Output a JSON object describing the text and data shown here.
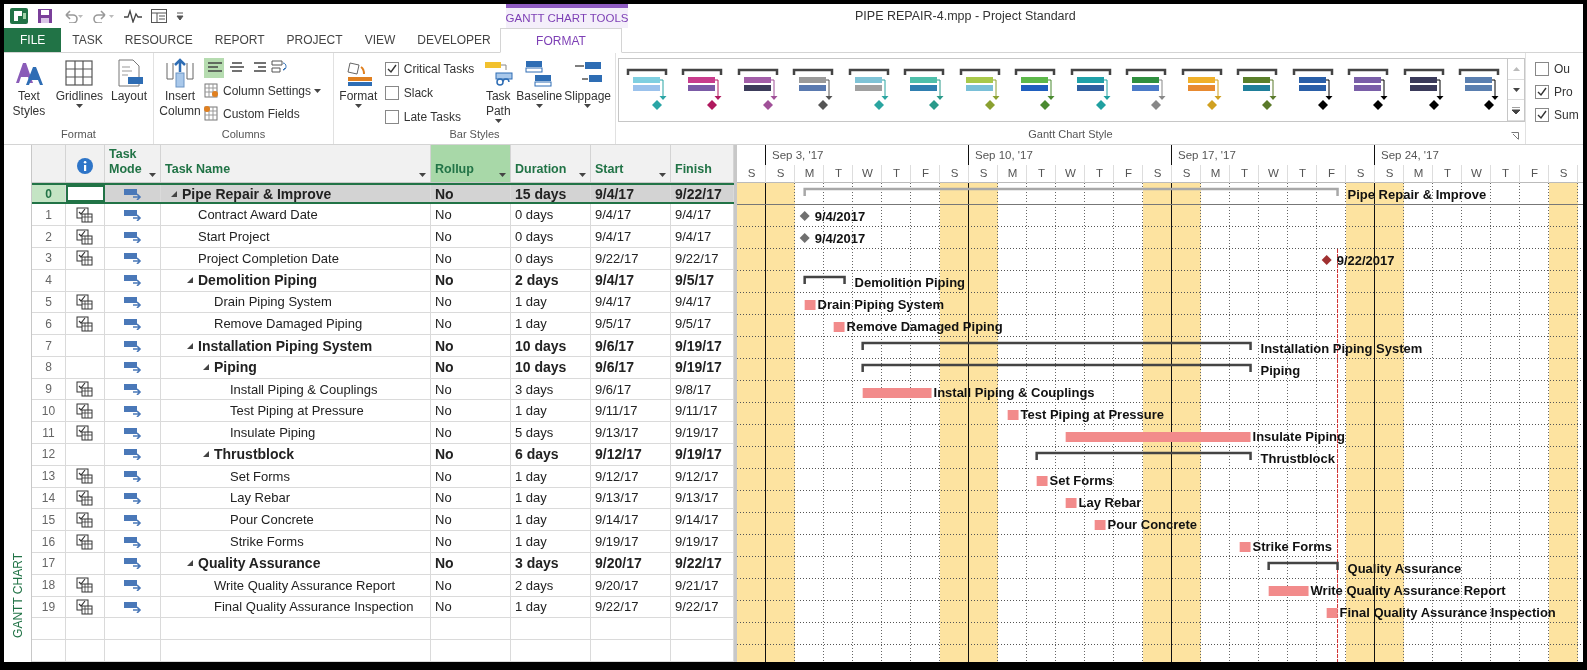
{
  "window": {
    "title": "PIPE REPAIR-4.mpp - Project Standard",
    "context_tab_group": "GANTT CHART TOOLS"
  },
  "tabs": [
    {
      "label": "FILE",
      "kind": "file",
      "selected": false
    },
    {
      "label": "TASK",
      "kind": "tab",
      "selected": false
    },
    {
      "label": "RESOURCE",
      "kind": "tab",
      "selected": false
    },
    {
      "label": "REPORT",
      "kind": "tab",
      "selected": false
    },
    {
      "label": "PROJECT",
      "kind": "tab",
      "selected": false
    },
    {
      "label": "VIEW",
      "kind": "tab",
      "selected": false
    },
    {
      "label": "DEVELOPER",
      "kind": "tab",
      "selected": false
    },
    {
      "label": "FORMAT",
      "kind": "context",
      "selected": true
    }
  ],
  "ribbon_groups": [
    {
      "label": "Format",
      "kind": "format",
      "buttons": [
        {
          "label": "Text Styles",
          "dropdown": false
        },
        {
          "label": "Gridlines",
          "dropdown": true
        },
        {
          "label": "Layout",
          "dropdown": false
        }
      ]
    },
    {
      "label": "Columns",
      "kind": "columns",
      "buttons": [
        {
          "label": "Insert Column",
          "dropdown": false
        }
      ],
      "alignment": [
        {
          "selected": true
        },
        {
          "selected": false
        },
        {
          "selected": false
        }
      ],
      "small_buttons": [
        {
          "label": "Column Settings",
          "dropdown": true
        },
        {
          "label": "Custom Fields",
          "dropdown": false
        }
      ]
    },
    {
      "label": "Bar Styles",
      "kind": "bar_styles",
      "buttons": [
        {
          "label": "Format",
          "dropdown": true
        }
      ],
      "checkboxes": [
        {
          "label": "Critical Tasks",
          "checked": true
        },
        {
          "label": "Slack",
          "checked": false
        },
        {
          "label": "Late Tasks",
          "checked": false
        }
      ],
      "more_buttons": [
        {
          "label": "Task Path",
          "dropdown": true
        },
        {
          "label": "Baseline",
          "dropdown": true
        },
        {
          "label": "Slippage",
          "dropdown": true
        }
      ]
    },
    {
      "label": "Gantt Chart Style",
      "kind": "gallery",
      "swatches": [
        {
          "parts": [
            {
              "kind": "bar",
              "color": "#7fcfe0"
            },
            {
              "kind": "bar",
              "color": "#9bc2ec"
            },
            {
              "kind": "milestone",
              "color": "#2aa5a5"
            }
          ]
        },
        {
          "parts": [
            {
              "kind": "bar",
              "color": "#c83c8c"
            },
            {
              "kind": "bar",
              "color": "#7b5aa6"
            },
            {
              "kind": "milestone",
              "color": "#b0185e"
            }
          ]
        },
        {
          "parts": [
            {
              "kind": "bar",
              "color": "#a25ea8"
            },
            {
              "kind": "bar",
              "color": "#3c3c5a"
            },
            {
              "kind": "milestone",
              "color": "#a05098"
            }
          ]
        },
        {
          "parts": [
            {
              "kind": "bar",
              "color": "#9a9a9a"
            },
            {
              "kind": "bar",
              "color": "#5a7ab0"
            },
            {
              "kind": "milestone",
              "color": "#555555"
            }
          ]
        },
        {
          "parts": [
            {
              "kind": "bar",
              "color": "#7fc3d6"
            },
            {
              "kind": "bar",
              "color": "#a0a0a0"
            },
            {
              "kind": "milestone",
              "color": "#2aa5a0"
            }
          ]
        },
        {
          "parts": [
            {
              "kind": "bar",
              "color": "#4fbfaa"
            },
            {
              "kind": "bar",
              "color": "#2f7fb0"
            },
            {
              "kind": "milestone",
              "color": "#2a9a8a"
            }
          ]
        },
        {
          "parts": [
            {
              "kind": "bar",
              "color": "#a8c84a"
            },
            {
              "kind": "bar",
              "color": "#7ac0d8"
            },
            {
              "kind": "milestone",
              "color": "#8aa030"
            }
          ]
        },
        {
          "parts": [
            {
              "kind": "bar",
              "color": "#5db84a"
            },
            {
              "kind": "bar",
              "color": "#1f5fbf"
            },
            {
              "kind": "milestone",
              "color": "#4a8a30"
            }
          ]
        },
        {
          "parts": [
            {
              "kind": "bar",
              "color": "#20a0a8"
            },
            {
              "kind": "bar",
              "color": "#2f5fa0"
            },
            {
              "kind": "milestone",
              "color": "#20a0a0"
            }
          ]
        },
        {
          "parts": [
            {
              "kind": "bar",
              "color": "#2f8f3f"
            },
            {
              "kind": "bar",
              "color": "#4a7ac8"
            },
            {
              "kind": "milestone",
              "color": "#888888"
            }
          ]
        },
        {
          "parts": [
            {
              "kind": "bar",
              "color": "#f0b02a"
            },
            {
              "kind": "bar",
              "color": "#e88a30"
            },
            {
              "kind": "milestone",
              "color": "#d0a020"
            }
          ]
        },
        {
          "parts": [
            {
              "kind": "bar",
              "color": "#5a7f2a"
            },
            {
              "kind": "bar",
              "color": "#1f7f9a"
            },
            {
              "kind": "milestone",
              "color": "#5a7a2a"
            }
          ]
        },
        {
          "parts": [
            {
              "kind": "bar",
              "color": "#2a5fa8"
            },
            {
              "kind": "bar",
              "color": "#2a5fa8"
            },
            {
              "kind": "milestone",
              "color": "#000000"
            }
          ]
        },
        {
          "parts": [
            {
              "kind": "bar",
              "color": "#7a5fa8"
            },
            {
              "kind": "bar",
              "color": "#7a5fa8"
            },
            {
              "kind": "milestone",
              "color": "#000000"
            }
          ]
        },
        {
          "parts": [
            {
              "kind": "bar",
              "color": "#3a3a5a"
            },
            {
              "kind": "bar",
              "color": "#3a3a5a"
            },
            {
              "kind": "milestone",
              "color": "#000000"
            }
          ]
        },
        {
          "parts": [
            {
              "kind": "bar",
              "color": "#5a7fb0"
            },
            {
              "kind": "bar",
              "color": "#5a7fb0"
            },
            {
              "kind": "milestone",
              "color": "#000000"
            }
          ]
        }
      ]
    },
    {
      "kind": "show_hide",
      "checkboxes": [
        {
          "label": "Ou",
          "checked": false
        },
        {
          "label": "Pro",
          "checked": true
        },
        {
          "label": "Sum",
          "checked": true
        }
      ]
    }
  ],
  "view_label": "GANTT CHART",
  "columns": [
    {
      "kind": "info",
      "selected": false
    },
    {
      "kind": "text",
      "label": "Task Mode",
      "dropdown": true,
      "selected": false
    },
    {
      "kind": "text",
      "label": "Task Name",
      "dropdown": true,
      "selected": false
    },
    {
      "kind": "text",
      "label": "Rollup",
      "dropdown": true,
      "selected": true
    },
    {
      "kind": "text",
      "label": "Duration",
      "dropdown": true,
      "selected": false
    },
    {
      "kind": "text",
      "label": "Start",
      "dropdown": true,
      "selected": false
    },
    {
      "kind": "text",
      "label": "Finish",
      "dropdown": false,
      "selected": false
    }
  ],
  "timescale": {
    "weeks": [
      {
        "label": "Sep 3, '17"
      },
      {
        "label": "Sep 10, '17"
      },
      {
        "label": "Sep 17, '17"
      },
      {
        "label": "Sep 24, '17"
      }
    ],
    "days": [
      {
        "label": "S",
        "weekend": true
      },
      {
        "label": "S",
        "weekend": true
      },
      {
        "label": "M",
        "weekend": false
      },
      {
        "label": "T",
        "weekend": false
      },
      {
        "label": "W",
        "weekend": false
      },
      {
        "label": "T",
        "weekend": false
      },
      {
        "label": "F",
        "weekend": false
      },
      {
        "label": "S",
        "weekend": true
      },
      {
        "label": "S",
        "weekend": true
      },
      {
        "label": "M",
        "weekend": false
      },
      {
        "label": "T",
        "weekend": false
      },
      {
        "label": "W",
        "weekend": false
      },
      {
        "label": "T",
        "weekend": false
      },
      {
        "label": "F",
        "weekend": false
      },
      {
        "label": "S",
        "weekend": true
      },
      {
        "label": "S",
        "weekend": true
      },
      {
        "label": "M",
        "weekend": false
      },
      {
        "label": "T",
        "weekend": false
      },
      {
        "label": "W",
        "weekend": false
      },
      {
        "label": "T",
        "weekend": false
      },
      {
        "label": "F",
        "weekend": false
      },
      {
        "label": "S",
        "weekend": true
      },
      {
        "label": "S",
        "weekend": true
      },
      {
        "label": "M",
        "weekend": false
      },
      {
        "label": "T",
        "weekend": false
      },
      {
        "label": "W",
        "weekend": false
      },
      {
        "label": "T",
        "weekend": false
      },
      {
        "label": "F",
        "weekend": false
      },
      {
        "label": "S",
        "weekend": true
      }
    ]
  },
  "tasks": [
    {
      "id": "0",
      "name": "Pipe Repair & Improve",
      "kind": "project",
      "expanded": true,
      "selected": true,
      "rollup": "No",
      "duration": "15 days",
      "start": "9/4/17",
      "finish": "9/22/17",
      "bar_label": "Pipe Repair & Improve",
      "children": [
        {
          "id": "1",
          "name": "Contract Award Date",
          "kind": "milestone",
          "critical": false,
          "selected": false,
          "rollup": "No",
          "duration": "0 days",
          "start": "9/4/17",
          "finish": "9/4/17",
          "bar_label": "9/4/2017"
        },
        {
          "id": "2",
          "name": "Start Project",
          "kind": "milestone",
          "critical": false,
          "selected": false,
          "rollup": "No",
          "duration": "0 days",
          "start": "9/4/17",
          "finish": "9/4/17",
          "bar_label": "9/4/2017"
        },
        {
          "id": "3",
          "name": "Project Completion Date",
          "kind": "milestone",
          "critical": true,
          "selected": false,
          "rollup": "No",
          "duration": "0 days",
          "start": "9/22/17",
          "finish": "9/22/17",
          "bar_label": "9/22/2017"
        },
        {
          "id": "4",
          "name": "Demolition Piping",
          "kind": "summary",
          "expanded": true,
          "selected": false,
          "rollup": "No",
          "duration": "2 days",
          "start": "9/4/17",
          "finish": "9/5/17",
          "bar_label": "Demolition Piping",
          "children": [
            {
              "id": "5",
              "name": "Drain Piping System",
              "kind": "task",
              "critical": true,
              "selected": false,
              "rollup": "No",
              "duration": "1 day",
              "start": "9/4/17",
              "finish": "9/4/17",
              "bar_label": "Drain Piping System"
            },
            {
              "id": "6",
              "name": "Remove Damaged Piping",
              "kind": "task",
              "critical": true,
              "selected": false,
              "rollup": "No",
              "duration": "1 day",
              "start": "9/5/17",
              "finish": "9/5/17",
              "bar_label": "Remove Damaged Piping"
            }
          ]
        },
        {
          "id": "7",
          "name": "Installation Piping System",
          "kind": "summary",
          "expanded": true,
          "selected": false,
          "rollup": "No",
          "duration": "10 days",
          "start": "9/6/17",
          "finish": "9/19/17",
          "bar_label": "Installation Piping System",
          "children": [
            {
              "id": "8",
              "name": "Piping",
              "kind": "summary",
              "expanded": true,
              "selected": false,
              "rollup": "No",
              "duration": "10 days",
              "start": "9/6/17",
              "finish": "9/19/17",
              "bar_label": "Piping",
              "children": [
                {
                  "id": "9",
                  "name": "Install Piping & Couplings",
                  "kind": "task",
                  "critical": true,
                  "selected": false,
                  "rollup": "No",
                  "duration": "3 days",
                  "start": "9/6/17",
                  "finish": "9/8/17",
                  "bar_label": "Install Piping & Couplings"
                },
                {
                  "id": "10",
                  "name": "Test Piping at Pressure",
                  "kind": "task",
                  "critical": true,
                  "selected": false,
                  "rollup": "No",
                  "duration": "1 day",
                  "start": "9/11/17",
                  "finish": "9/11/17",
                  "bar_label": "Test Piping at Pressure"
                },
                {
                  "id": "11",
                  "name": "Insulate Piping",
                  "kind": "task",
                  "critical": true,
                  "selected": false,
                  "rollup": "No",
                  "duration": "5 days",
                  "start": "9/13/17",
                  "finish": "9/19/17",
                  "bar_label": "Insulate Piping"
                }
              ]
            },
            {
              "id": "12",
              "name": "Thrustblock",
              "kind": "summary",
              "expanded": true,
              "selected": false,
              "rollup": "No",
              "duration": "6 days",
              "start": "9/12/17",
              "finish": "9/19/17",
              "bar_label": "Thrustblock",
              "children": [
                {
                  "id": "13",
                  "name": "Set Forms",
                  "kind": "task",
                  "critical": true,
                  "selected": false,
                  "rollup": "No",
                  "duration": "1 day",
                  "start": "9/12/17",
                  "finish": "9/12/17",
                  "bar_label": "Set Forms"
                },
                {
                  "id": "14",
                  "name": "Lay Rebar",
                  "kind": "task",
                  "critical": true,
                  "selected": false,
                  "rollup": "No",
                  "duration": "1 day",
                  "start": "9/13/17",
                  "finish": "9/13/17",
                  "bar_label": "Lay Rebar"
                },
                {
                  "id": "15",
                  "name": "Pour Concrete",
                  "kind": "task",
                  "critical": true,
                  "selected": false,
                  "rollup": "No",
                  "duration": "1 day",
                  "start": "9/14/17",
                  "finish": "9/14/17",
                  "bar_label": "Pour Concrete"
                },
                {
                  "id": "16",
                  "name": "Strike Forms",
                  "kind": "task",
                  "critical": true,
                  "selected": false,
                  "rollup": "No",
                  "duration": "1 day",
                  "start": "9/19/17",
                  "finish": "9/19/17",
                  "bar_label": "Strike Forms"
                }
              ]
            }
          ]
        },
        {
          "id": "17",
          "name": "Quality Assurance",
          "kind": "summary",
          "expanded": true,
          "selected": false,
          "rollup": "No",
          "duration": "3 days",
          "start": "9/20/17",
          "finish": "9/22/17",
          "bar_label": "Quality Assurance",
          "children": [
            {
              "id": "18",
              "name": "Write Quality Assurance Report",
              "kind": "task",
              "critical": true,
              "selected": false,
              "rollup": "No",
              "duration": "2 days",
              "start": "9/20/17",
              "finish": "9/21/17",
              "bar_label": "Write Quality Assurance Report"
            },
            {
              "id": "19",
              "name": "Final Quality Assurance Inspection",
              "kind": "task",
              "critical": true,
              "selected": false,
              "rollup": "No",
              "duration": "1 day",
              "start": "9/22/17",
              "finish": "9/22/17",
              "bar_label": "Final Quality Assurance Inspection"
            }
          ]
        }
      ]
    }
  ]
}
